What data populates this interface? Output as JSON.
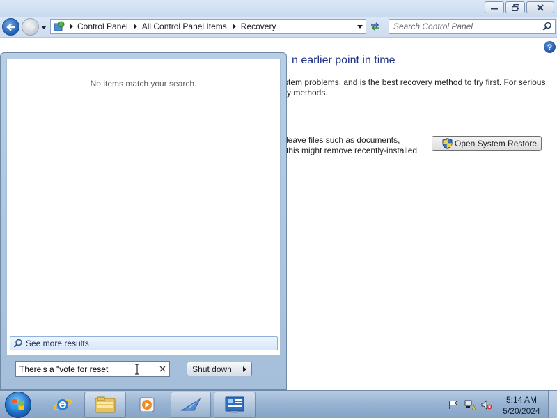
{
  "window": {
    "caption_buttons": {
      "minimize_icon": "minimize-icon",
      "maximize_icon": "restore-window-icon",
      "close_icon": "close-icon"
    },
    "breadcrumbs": [
      "Control Panel",
      "All Control Panel Items",
      "Recovery"
    ],
    "search": {
      "placeholder": "Search Control Panel"
    },
    "help_label": "?"
  },
  "content": {
    "heading_fragment": "n earlier point in time",
    "description_line1": "stem problems, and is the best recovery method to try first. For serious",
    "description_line2": "ry methods.",
    "restore_text_line1": "leave files such as documents,",
    "restore_text_line2": "this might remove recently-installed",
    "open_system_restore_label": "Open System Restore"
  },
  "start_menu": {
    "no_items_text": "No items match your search.",
    "see_more_label": "See more results",
    "search_value": "There's a \"vote for reset",
    "shutdown_label": "Shut down"
  },
  "taskbar": {
    "pinned": [
      "start-orb",
      "internet-explorer-icon",
      "windows-explorer-icon",
      "media-player-icon",
      "remote-app-icon",
      "control-panel-icon"
    ],
    "clock_time": "5:14 AM",
    "clock_date": "5/20/2024"
  },
  "colors": {
    "heading": "#1e3287",
    "taskbar": "#99b4d3",
    "start_menu_frame": "#a2bcd8"
  }
}
